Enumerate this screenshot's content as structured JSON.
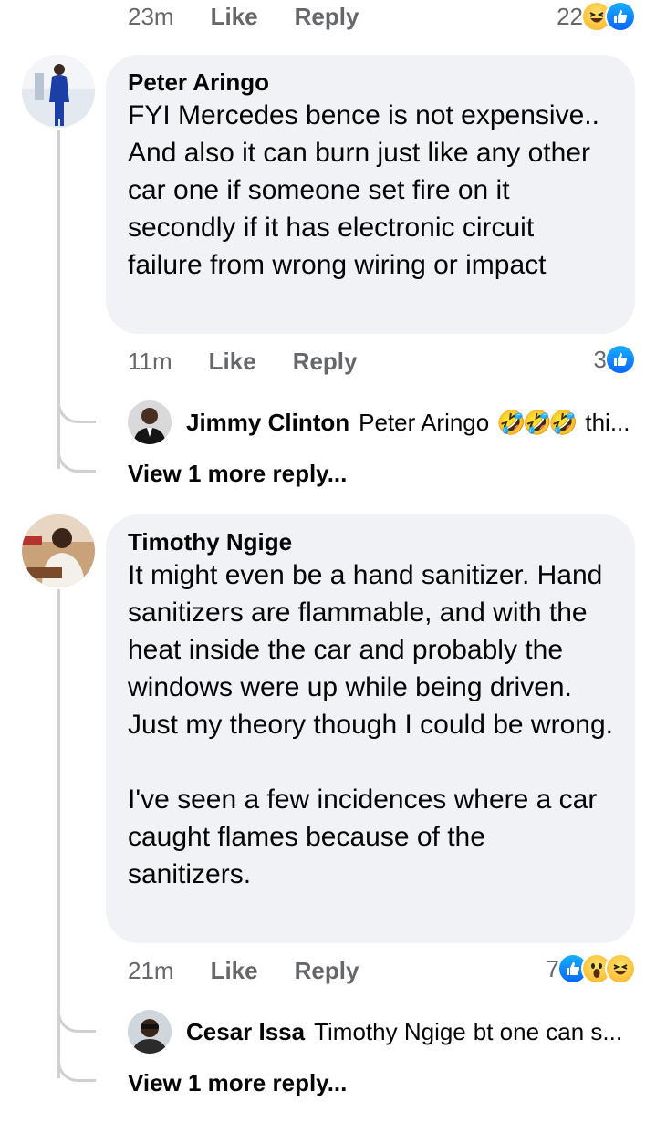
{
  "colors": {
    "accent": "#0866ff",
    "bubble_bg": "#f0f2f5",
    "meta_text": "#65676b",
    "thread_line": "#ced0d4"
  },
  "top_comment": {
    "time": "23m",
    "like_label": "Like",
    "reply_label": "Reply",
    "reaction_count": "22",
    "reactions": [
      "haha-icon",
      "like-icon"
    ]
  },
  "comments": [
    {
      "author": "Peter Aringo",
      "text": "FYI Mercedes bence is not expensive.. And also it can burn just like any other car one if someone set fire on it secondly if it has electronic circuit failure from wrong wiring or impact",
      "time": "11m",
      "like_label": "Like",
      "reply_label": "Reply",
      "reaction_count": "3",
      "reactions": [
        "like-icon"
      ],
      "reply": {
        "author": "Jimmy Clinton",
        "mention": "Peter Aringo",
        "emoji": "🤣🤣🤣",
        "text": "thi..."
      },
      "view_more": "View 1 more reply..."
    },
    {
      "author": "Timothy Ngige",
      "text": "It might even be a hand sanitizer. Hand sanitizers are flammable, and with the heat inside the car and probably the windows were up while being driven. Just my theory though I could be wrong.\n\nI've seen a few incidences where a car caught flames because of the sanitizers.",
      "time": "21m",
      "like_label": "Like",
      "reply_label": "Reply",
      "reaction_count": "7",
      "reactions": [
        "like-icon",
        "wow-icon",
        "haha-icon"
      ],
      "reply": {
        "author": "Cesar Issa",
        "mention": "Timothy Ngige",
        "text": "bt one can s..."
      },
      "view_more": "View 1 more reply..."
    }
  ]
}
